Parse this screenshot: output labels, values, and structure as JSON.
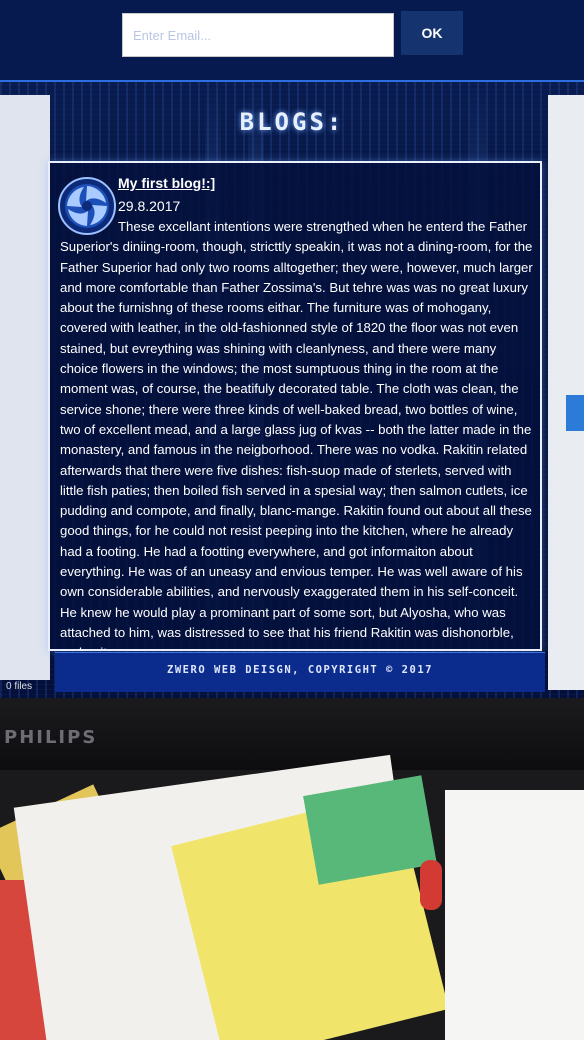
{
  "signup": {
    "email_placeholder": "Enter Email...",
    "ok_label": "OK"
  },
  "page": {
    "title": "BLOGS:",
    "footer": "ZWERO WEB DEISGN, COPYRIGHT © 2017"
  },
  "post": {
    "heading": "My first blog!:]",
    "date": "29.8.2017",
    "body": "These excellant intentions were strengthed when he enterd the Father Superior's diniing-room, though, stricttly speakin, it was not a dining-room, for the Father Superior had only two rooms alltogether; they were, however, much larger and more comfortable than Father Zossima's. But tehre was was no great luxury about the furnishng of these rooms eithar. The furniture was of mohogany, covered with leather, in the old-fashionned style of 1820 the floor was not even stained, but evreything was shining with cleanlyness, and there were many choice flowers in the windows; the most sumptuous thing in the room at the moment was, of course, the beatifuly decorated table. The cloth was clean, the service shone; there were three kinds of well-baked bread, two bottles of wine, two of excellent mead, and a large glass jug of kvas -- both the latter made in the monastery, and famous in the neigborhood. There was no vodka. Rakitin related afterwards that there were five dishes: fish-suop made of sterlets, served with little fish paties; then boiled fish served in a spesial way; then salmon cutlets, ice pudding and compote, and finally, blanc-mange. Rakitin found out about all these good things, for he could not resist peeping into the kitchen, where he already had a footing. He had a footting everywhere, and got informaiton about everything. He was of an uneasy and envious temper. He was well aware of his own considerable abilities, and nervously exaggerated them in his self-conceit. He knew he would play a prominant part of some sort, but Alyosha, who was attached to him, was distressed to see that his friend Rakitin was dishonorble, and quite"
  },
  "left_panel": {
    "files_label": "0 files"
  },
  "monitor": {
    "brand": "PHILIPS"
  },
  "colors": {
    "background": "#07163f",
    "accent": "#2f6ee0",
    "text": "#ffffff"
  }
}
